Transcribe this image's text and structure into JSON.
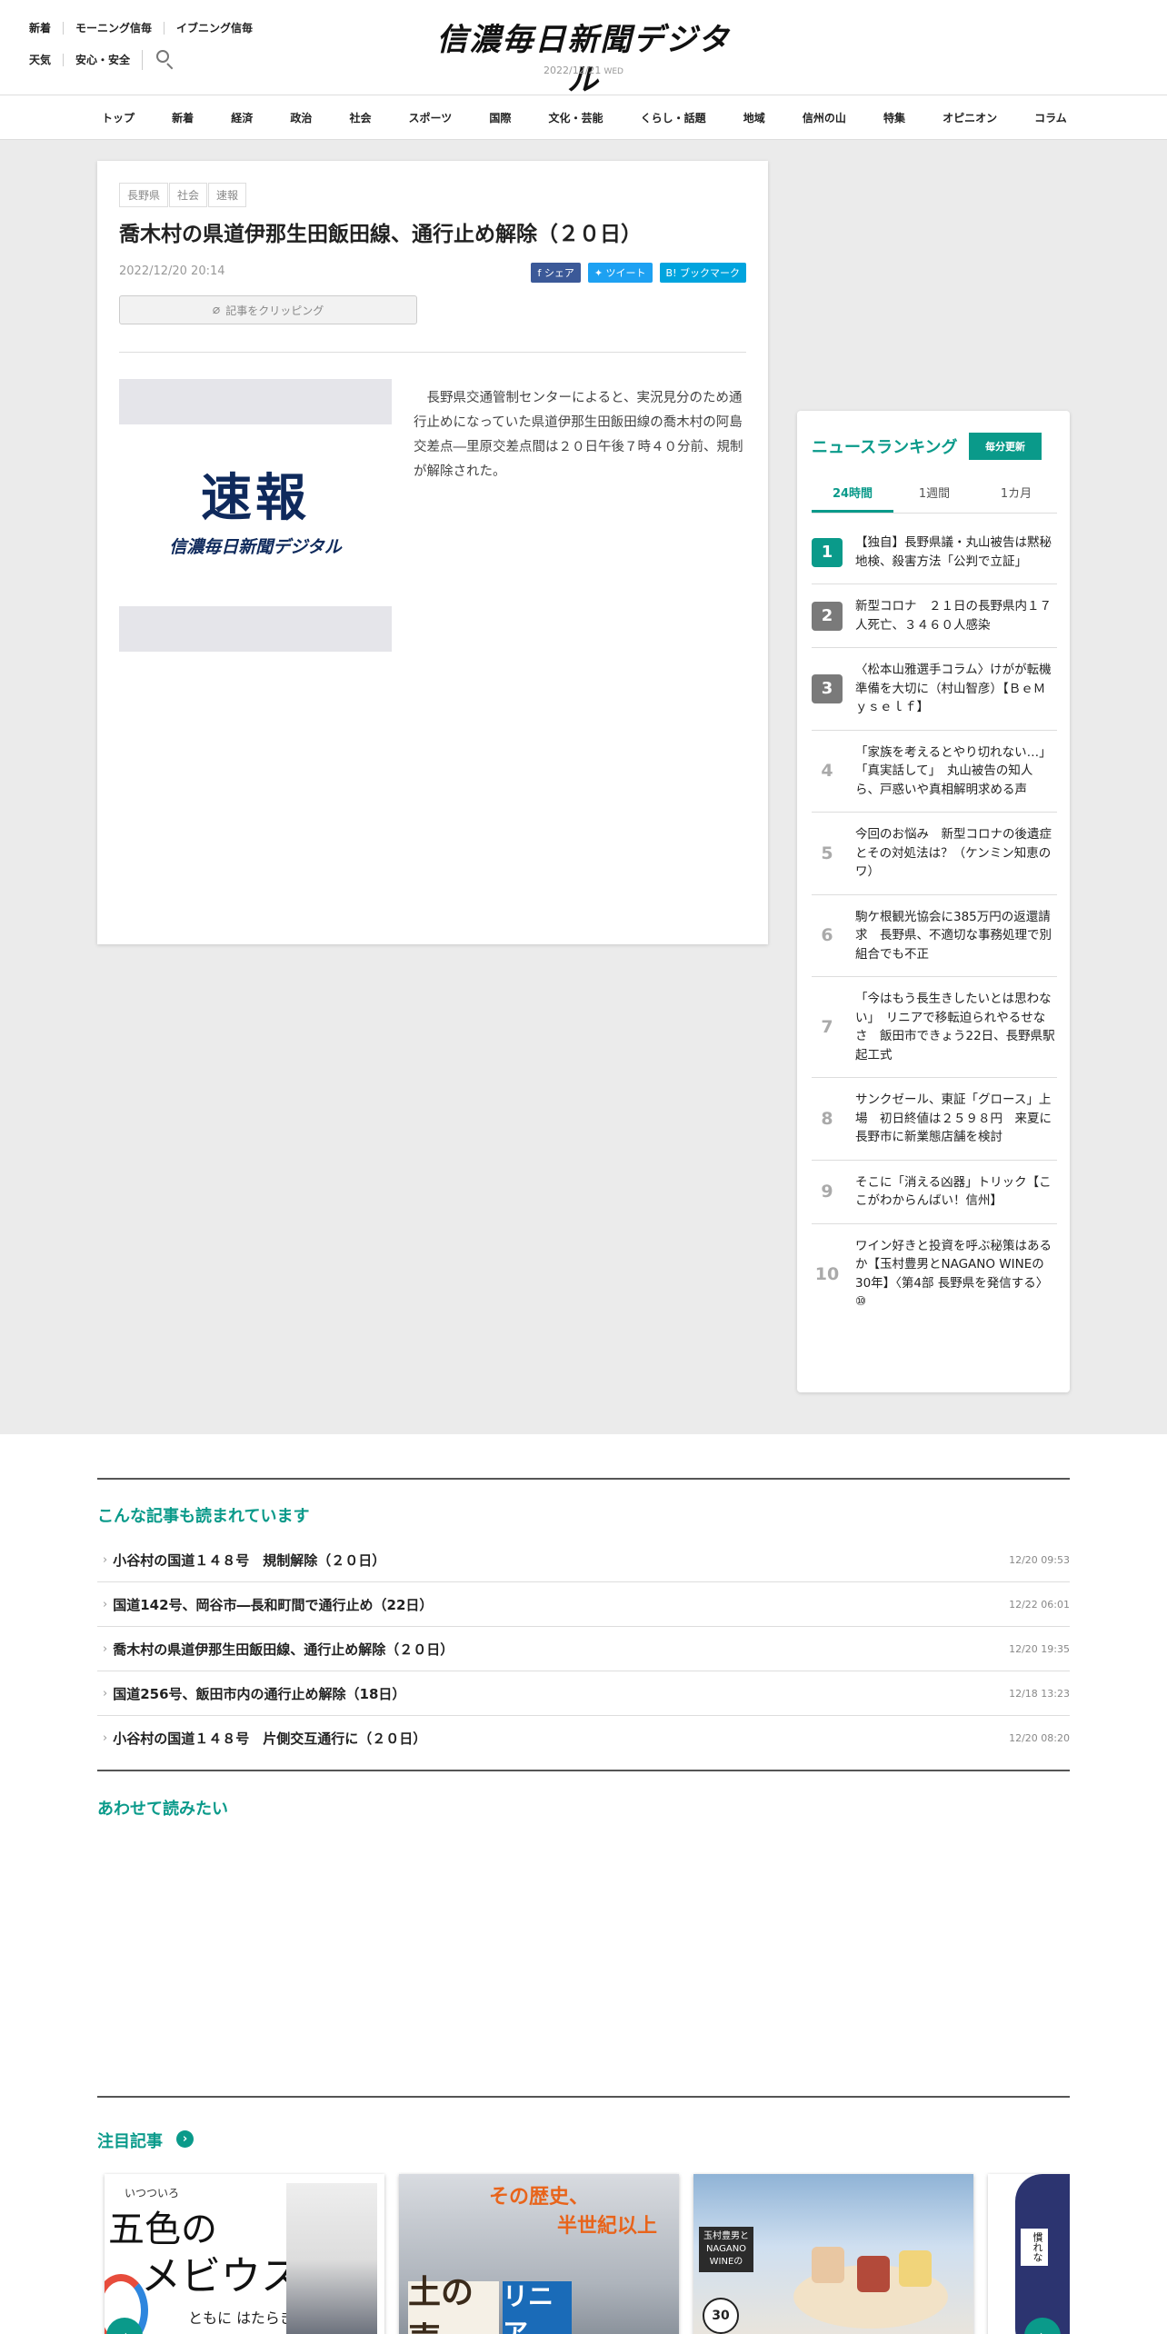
{
  "header": {
    "util_row1": [
      "新着",
      "モーニング信毎",
      "イブニング信毎"
    ],
    "util_row2": [
      "天気",
      "安心・安全"
    ],
    "logo": "信濃毎日新聞デジタル",
    "date": "2022/12/21",
    "dow": "WED"
  },
  "nav": [
    "トップ",
    "新着",
    "経済",
    "政治",
    "社会",
    "スポーツ",
    "国際",
    "文化・芸能",
    "くらし・話題",
    "地域",
    "信州の山",
    "特集",
    "オピニオン",
    "コラム"
  ],
  "article": {
    "tags": [
      "長野県",
      "社会",
      "速報"
    ],
    "title": "喬木村の県道伊那生田飯田線、通行止め解除（２０日）",
    "published": "2022/12/20 20:14",
    "share_facebook": "シェア",
    "share_twitter": "ツイート",
    "share_hatena": "ブックマーク",
    "clip_label": "記事をクリッピング",
    "thumb_flash": "速報",
    "thumb_sub": "信濃毎日新聞デジタル",
    "body": "長野県交通管制センターによると、実況見分のため通行止めになっていた県道伊那生田飯田線の喬木村の阿島交差点―里原交差点間は２０日午後７時４０分前、規制が解除された。"
  },
  "ranking": {
    "title": "ニュースランキング",
    "badge": "毎分更新",
    "tabs": [
      "24時間",
      "1週間",
      "1カ月"
    ],
    "items": [
      {
        "num": "1",
        "text": "【独自】長野県議・丸山被告は黙秘　地検、殺害方法「公判で立証」"
      },
      {
        "num": "2",
        "text": "新型コロナ　２１日の長野県内１７人死亡、３４６０人感染"
      },
      {
        "num": "3",
        "text": "〈松本山雅選手コラム〉けがが転機　準備を大切に（村山智彦）【ＢｅＭｙｓｅｌｆ】"
      },
      {
        "num": "4",
        "text": "「家族を考えるとやり切れない…」「真実話して」　丸山被告の知人ら、戸惑いや真相解明求める声"
      },
      {
        "num": "5",
        "text": "今回のお悩み　新型コロナの後遺症とその対処法は？（ケンミン知恵のワ）"
      },
      {
        "num": "6",
        "text": "駒ケ根観光協会に385万円の返還請求　長野県、不適切な事務処理で別組合でも不正"
      },
      {
        "num": "7",
        "text": "「今はもう長生きしたいとは思わない」　リニアで移転迫られやるせなさ　飯田市できょう22日、長野県駅起工式"
      },
      {
        "num": "8",
        "text": "サンクゼール、東証「グロース」上場　初日終値は２５９８円　来夏に長野市に新業態店舗を検討"
      },
      {
        "num": "9",
        "text": "そこに「消える凶器」トリック【ここがわからんばい！信州】"
      },
      {
        "num": "10",
        "text": "ワイン好きと投資を呼ぶ秘策はあるか【玉村豊男とNAGANO WINEの30年】〈第4部 長野県を発信する〉⑩"
      }
    ]
  },
  "related": {
    "title": "こんな記事も読まれています",
    "items": [
      {
        "title": "小谷村の国道１４８号　規制解除（２０日）",
        "time": "12/20 09:53"
      },
      {
        "title": "国道142号、岡谷市―長和町間で通行止め（22日）",
        "time": "12/22 06:01"
      },
      {
        "title": "喬木村の県道伊那生田飯田線、通行止め解除（２０日）",
        "time": "12/20 19:35"
      },
      {
        "title": "国道256号、飯田市内の通行止め解除（18日）",
        "time": "12/18 13:23"
      },
      {
        "title": "小谷村の国道１４８号　片側交互通行に（２０日）",
        "time": "12/20 08:20"
      }
    ]
  },
  "read_together": {
    "title": "あわせて読みたい"
  },
  "attention": {
    "title": "注目記事",
    "cards": [
      {
        "small": "いつついろ",
        "big1": "五色の",
        "big2": "メビウス",
        "sub": "ともに はたらき"
      },
      {
        "line1": "その歴史、",
        "line2": "半世紀以上",
        "box1": "土の声",
        "box2": "リニア"
      },
      {
        "label": "玉村豊男とNAGANO WINEの",
        "badge": "30"
      },
      {
        "text": "慣れな"
      }
    ]
  },
  "colors": {
    "accent": "#0a9a8a",
    "band": "#ebebeb"
  }
}
